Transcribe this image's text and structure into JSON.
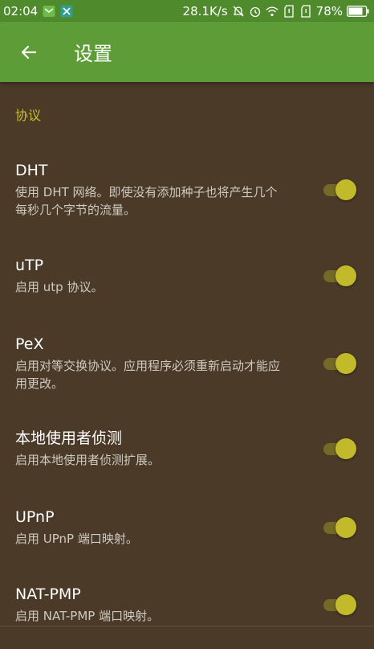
{
  "status_bar": {
    "time": "02:04",
    "net_speed": "28.1K/s",
    "battery": "78%"
  },
  "app_bar": {
    "title": "设置"
  },
  "section": {
    "header": "协议"
  },
  "prefs": [
    {
      "title": "DHT",
      "summary": "使用 DHT 网络。即使没有添加种子也将产生几个每秒几个字节的流量。",
      "enabled": true
    },
    {
      "title": "uTP",
      "summary": "启用 utp 协议。",
      "enabled": true
    },
    {
      "title": "PeX",
      "summary": "启用对等交换协议。应用程序必须重新启动才能应用更改。",
      "enabled": true
    },
    {
      "title": "本地使用者侦测",
      "summary": "启用本地使用者侦测扩展。",
      "enabled": true
    },
    {
      "title": "UPnP",
      "summary": "启用 UPnP 端口映射。",
      "enabled": true
    },
    {
      "title": "NAT-PMP",
      "summary": "启用 NAT-PMP 端口映射。",
      "enabled": true
    }
  ],
  "colors": {
    "status_bar": "#4f8a2c",
    "app_bar": "#5d9c37",
    "background": "#4a3a27",
    "accent": "#c2b92b"
  }
}
